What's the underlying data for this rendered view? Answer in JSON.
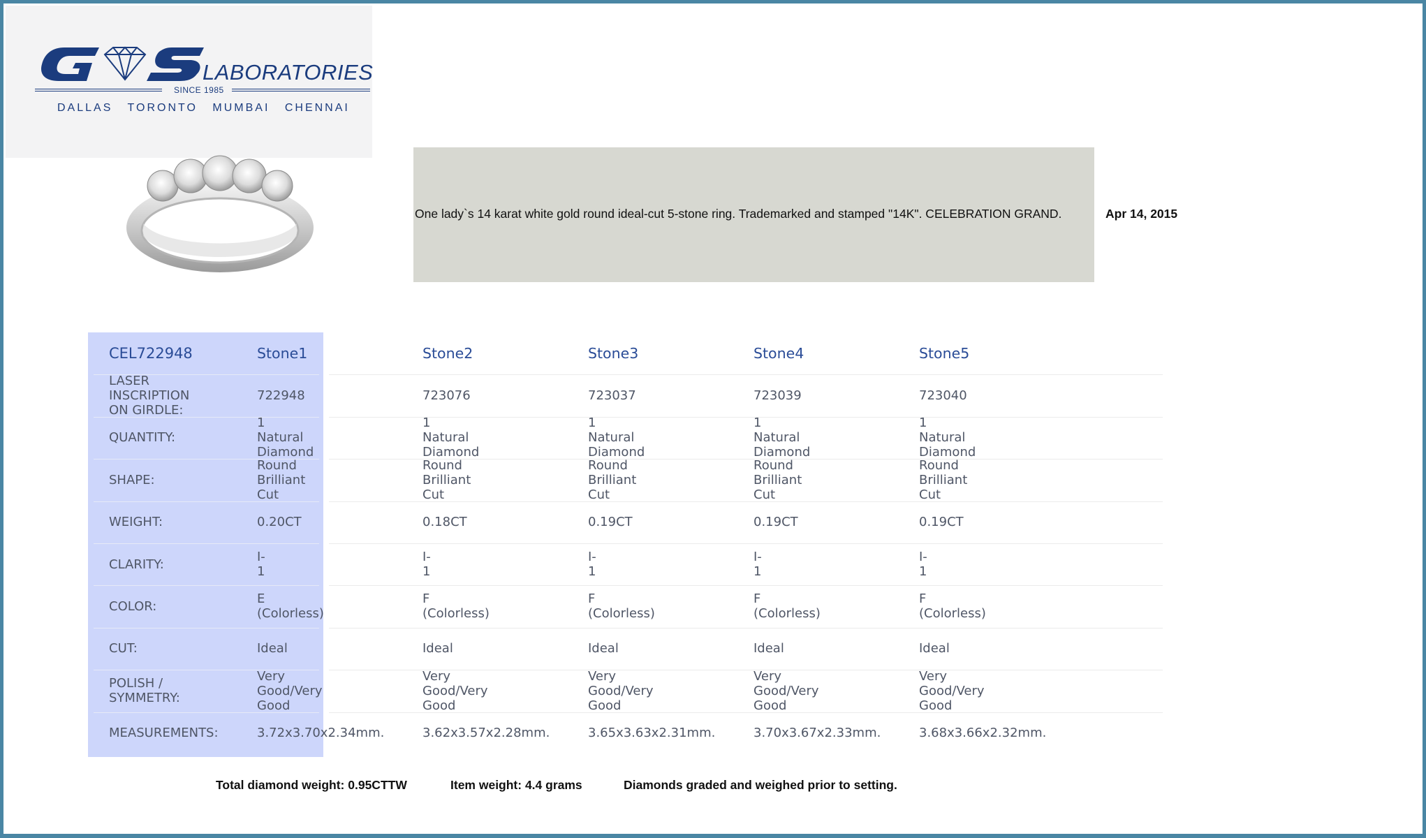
{
  "logo": {
    "brand_letters": "G S",
    "laboratories": "LABORATORIES",
    "since": "SINCE 1985",
    "cities": "DALLAS TORONTO MUMBAI CHENNAI"
  },
  "description": "One lady`s 14 karat white gold round ideal-cut 5-stone ring. Trademarked and stamped \"14K\".   CELEBRATION GRAND.",
  "date": "Apr 14, 2015",
  "table": {
    "id": "CEL722948",
    "stones": [
      "Stone1",
      "Stone2",
      "Stone3",
      "Stone4",
      "Stone5"
    ],
    "rows": [
      {
        "label": "LASER INSCRIPTION ON GIRDLE:",
        "values": [
          "722948",
          "723076",
          "723037",
          "723039",
          "723040"
        ]
      },
      {
        "label": "QUANTITY:",
        "values": [
          "1 Natural Diamond",
          "1 Natural Diamond",
          "1 Natural Diamond",
          "1 Natural Diamond",
          "1 Natural Diamond"
        ]
      },
      {
        "label": "SHAPE:",
        "values": [
          "Round Brilliant Cut",
          "Round Brilliant Cut",
          "Round Brilliant Cut",
          "Round Brilliant Cut",
          "Round Brilliant Cut"
        ]
      },
      {
        "label": "WEIGHT:",
        "values": [
          "0.20CT",
          "0.18CT",
          "0.19CT",
          "0.19CT",
          "0.19CT"
        ]
      },
      {
        "label": "CLARITY:",
        "values": [
          "I-1",
          "I-1",
          "I-1",
          "I-1",
          "I-1"
        ]
      },
      {
        "label": "COLOR:",
        "values": [
          "E (Colorless)",
          "F (Colorless)",
          "F (Colorless)",
          "F (Colorless)",
          "F (Colorless)"
        ]
      },
      {
        "label": "CUT:",
        "values": [
          "Ideal",
          "Ideal",
          "Ideal",
          "Ideal",
          "Ideal"
        ]
      },
      {
        "label": "POLISH / SYMMETRY:",
        "values": [
          "Very Good/Very Good",
          "Very Good/Very Good",
          "Very Good/Very Good",
          "Very Good/Very Good",
          "Very Good/Very Good"
        ]
      },
      {
        "label": "MEASUREMENTS:",
        "values": [
          "3.72x3.70x2.34mm.",
          "3.62x3.57x2.28mm.",
          "3.65x3.63x2.31mm.",
          "3.70x3.67x2.33mm.",
          "3.68x3.66x2.32mm."
        ]
      }
    ]
  },
  "footer": {
    "total_weight": "Total diamond weight: 0.95CTTW",
    "item_weight": "Item weight: 4.4 grams",
    "note": "Diamonds graded and weighed prior to setting."
  },
  "colors": {
    "frame": "#4a86a4",
    "brand_blue": "#1b3c7e",
    "label_column": "#cdd6fb",
    "description_box": "#d7d8d1"
  }
}
